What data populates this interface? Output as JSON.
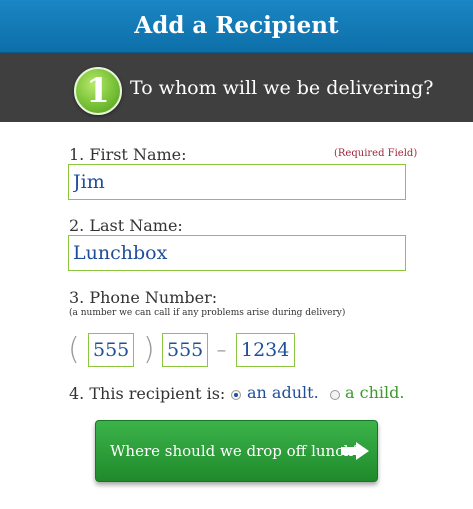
{
  "header": {
    "title": "Add a Recipient"
  },
  "step": {
    "number": "1",
    "title": "To whom will we be delivering?"
  },
  "form": {
    "first_name": {
      "label": "1. First Name:",
      "value": "Jim",
      "required_note": "(Required Field)"
    },
    "last_name": {
      "label": "2. Last Name:",
      "value": "Lunchbox"
    },
    "phone": {
      "label": "3. Phone Number:",
      "hint": "(a number we can call if any problems arise during delivery)",
      "open_paren": "(",
      "close_paren": ")",
      "dash": "-",
      "area": "555",
      "prefix": "555",
      "line": "1234"
    },
    "recipient_type": {
      "label": "4. This recipient is:",
      "options": [
        {
          "label": "an adult.",
          "color": "#1f4f9a",
          "selected": true
        },
        {
          "label": "a child.",
          "color": "#3c9a2a",
          "selected": false
        }
      ]
    }
  },
  "cta": {
    "label": "Where should we drop off lunch?",
    "icon": "arrow-right-icon"
  }
}
